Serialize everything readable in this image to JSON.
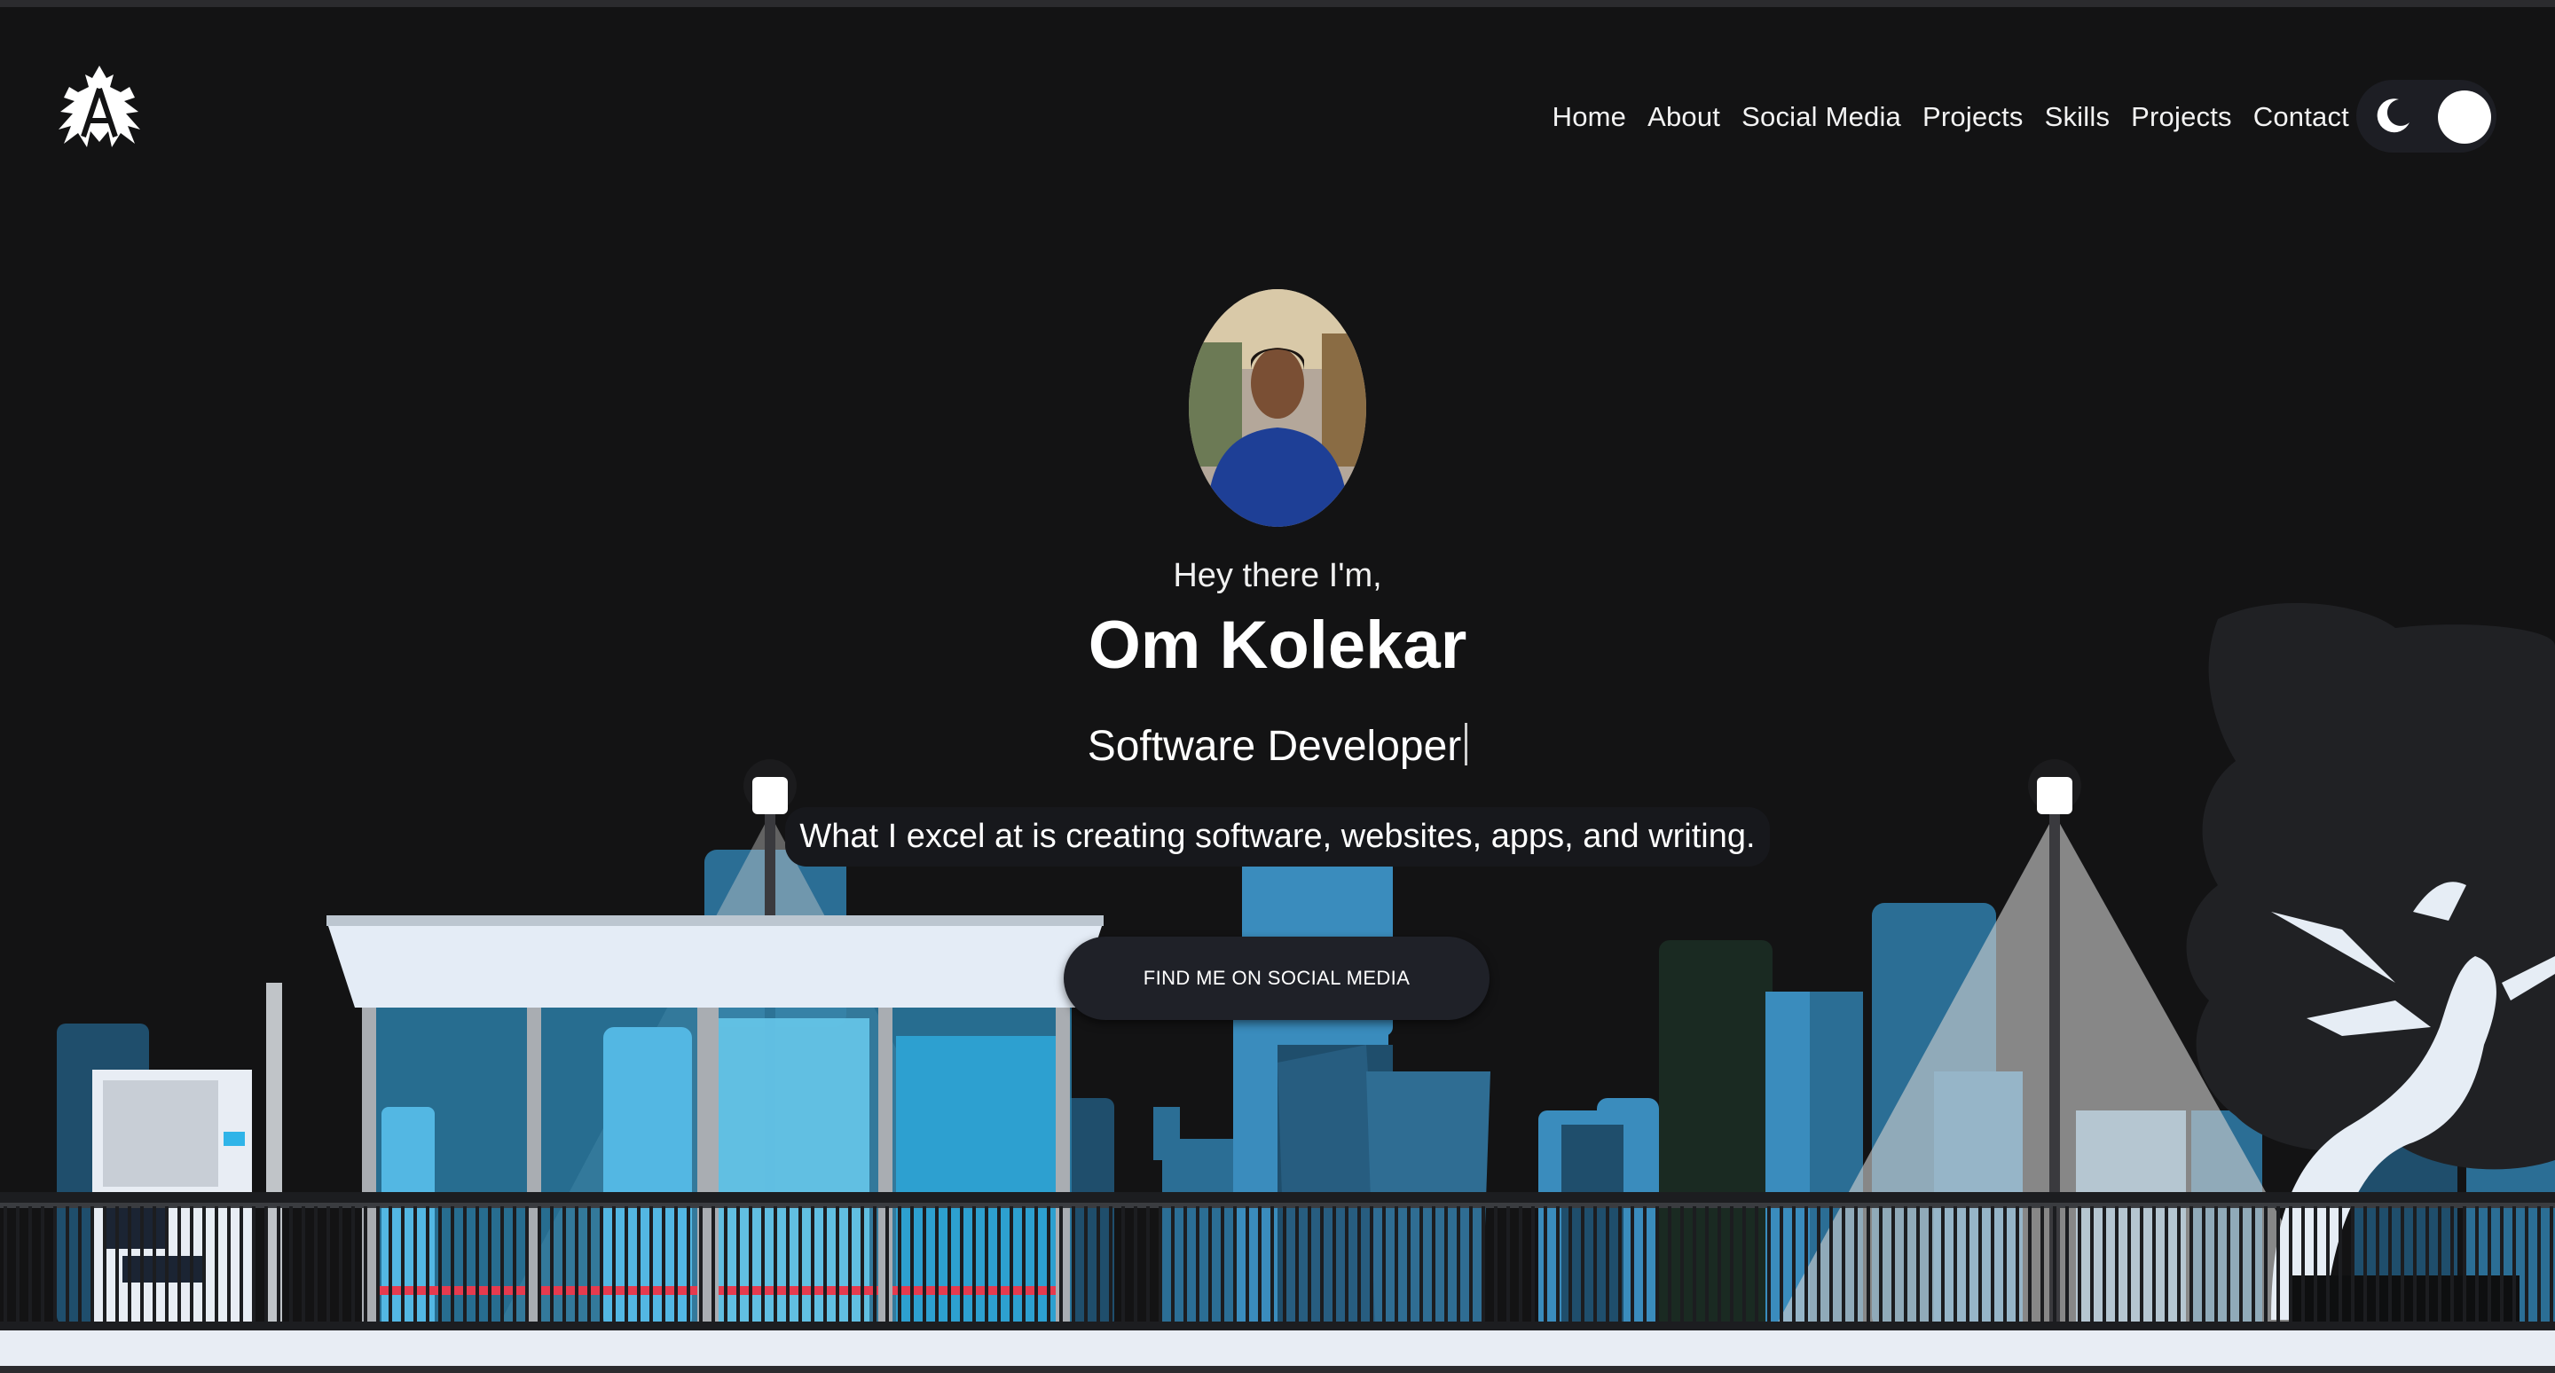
{
  "nav": {
    "items": [
      {
        "label": "Home"
      },
      {
        "label": "About"
      },
      {
        "label": "Social Media"
      },
      {
        "label": "Projects"
      },
      {
        "label": "Skills"
      },
      {
        "label": "Projects"
      },
      {
        "label": "Contact"
      }
    ]
  },
  "theme_toggle": {
    "state": "dark",
    "icon": "moon-icon"
  },
  "hero": {
    "greeting": "Hey there I'm,",
    "name": "Om Kolekar",
    "role": "Software Developer",
    "tagline": "What I excel at is creating software, websites, apps, and writing.",
    "cta_label": "FIND ME ON SOCIAL MEDIA"
  },
  "colors": {
    "background": "#131314",
    "text": "#ffffff",
    "city_blue": "#3c8fc0",
    "city_dark": "#1e4e6b",
    "light_cone": "#c8c8c8"
  }
}
